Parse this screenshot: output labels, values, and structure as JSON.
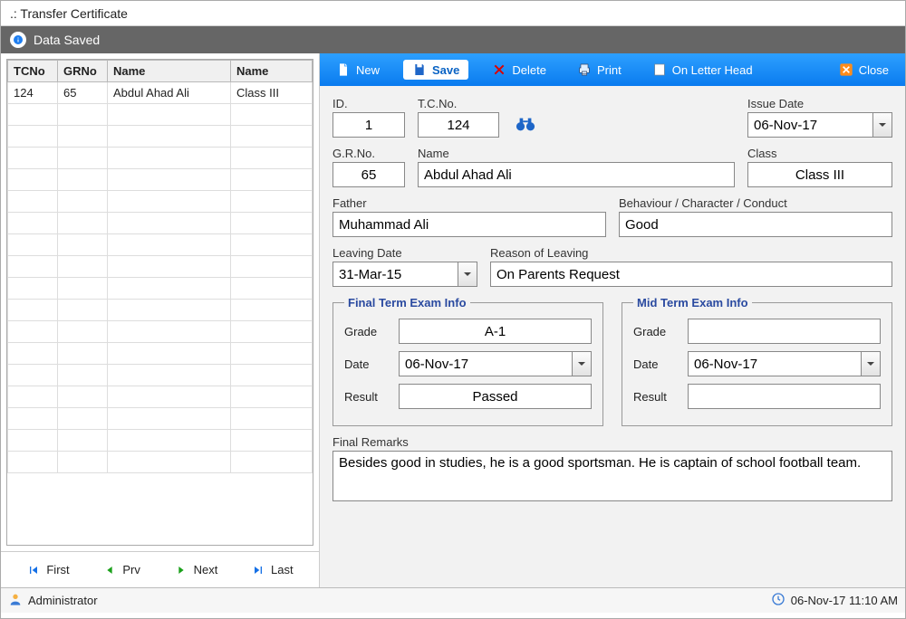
{
  "window": {
    "title": ".: Transfer Certificate"
  },
  "status": {
    "message": "Data Saved"
  },
  "grid": {
    "headers": [
      "TCNo",
      "GRNo",
      "Name",
      "Name"
    ],
    "rows": [
      {
        "tcno": "124",
        "grno": "65",
        "name": "Abdul Ahad Ali",
        "class": "Class III"
      }
    ]
  },
  "nav": {
    "first": "First",
    "prev": "Prv",
    "next": "Next",
    "last": "Last"
  },
  "toolbar": {
    "new": "New",
    "save": "Save",
    "delete": "Delete",
    "print": "Print",
    "letterhead": "On Letter Head",
    "close": "Close"
  },
  "form": {
    "labels": {
      "id": "ID.",
      "tcno": "T.C.No.",
      "issue_date": "Issue Date",
      "grno": "G.R.No.",
      "name": "Name",
      "class": "Class",
      "father": "Father",
      "behaviour": "Behaviour / Character / Conduct",
      "leaving_date": "Leaving Date",
      "reason": "Reason of Leaving",
      "final_term_legend": "Final Term Exam Info",
      "mid_term_legend": "Mid Term Exam Info",
      "grade": "Grade",
      "date": "Date",
      "result": "Result",
      "final_remarks": "Final Remarks"
    },
    "values": {
      "id": "1",
      "tcno": "124",
      "issue_date": "06-Nov-17",
      "grno": "65",
      "name": "Abdul Ahad Ali",
      "class": "Class III",
      "father": "Muhammad Ali",
      "behaviour": "Good",
      "leaving_date": "31-Mar-15",
      "reason": "On Parents Request",
      "final_term": {
        "grade": "A-1",
        "date": "06-Nov-17",
        "result": "Passed"
      },
      "mid_term": {
        "grade": "",
        "date": "06-Nov-17",
        "result": ""
      },
      "final_remarks": "Besides good in studies, he is a good sportsman. He is captain of school football team."
    }
  },
  "footer": {
    "user": "Administrator",
    "datetime": "06-Nov-17 11:10 AM"
  }
}
